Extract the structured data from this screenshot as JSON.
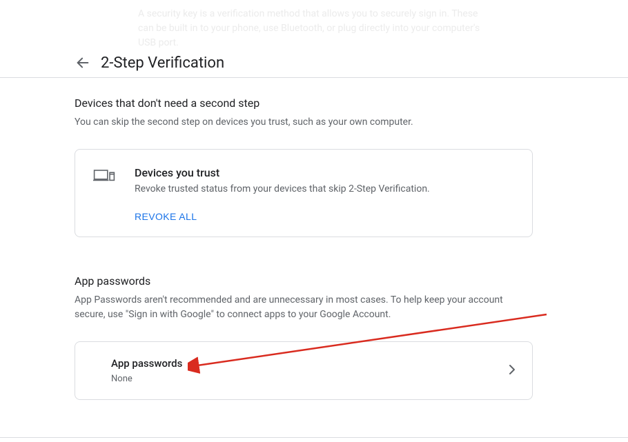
{
  "faded_text": "A security key is a verification method that allows you to securely sign in. These can be built in to your phone, use Bluetooth, or plug directly into your computer's USB port.",
  "page_title": "2-Step Verification",
  "devices_section": {
    "title": "Devices that don't need a second step",
    "subtitle": "You can skip the second step on devices you trust, such as your own computer.",
    "card": {
      "title": "Devices you trust",
      "desc": "Revoke trusted status from your devices that skip 2-Step Verification.",
      "action": "REVOKE ALL"
    }
  },
  "app_pw_section": {
    "title": "App passwords",
    "subtitle": "App Passwords aren't recommended and are unnecessary in most cases. To help keep your account secure, use \"Sign in with Google\" to connect apps to your Google Account.",
    "card": {
      "title": "App passwords",
      "value": "None"
    }
  }
}
